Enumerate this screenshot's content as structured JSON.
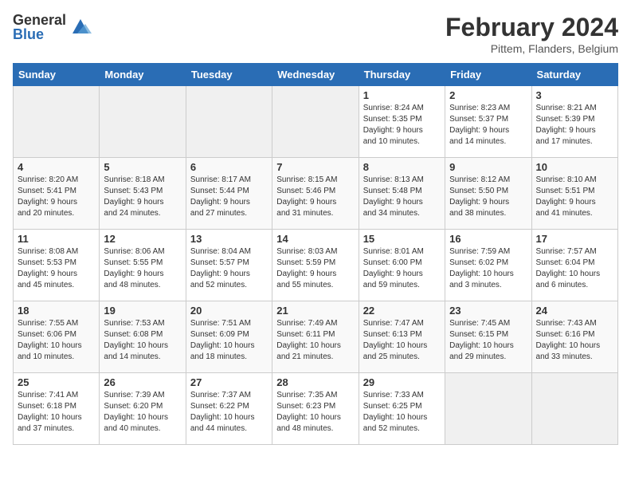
{
  "header": {
    "logo_general": "General",
    "logo_blue": "Blue",
    "month": "February 2024",
    "location": "Pittem, Flanders, Belgium"
  },
  "days_of_week": [
    "Sunday",
    "Monday",
    "Tuesday",
    "Wednesday",
    "Thursday",
    "Friday",
    "Saturday"
  ],
  "weeks": [
    [
      {
        "day": "",
        "info": ""
      },
      {
        "day": "",
        "info": ""
      },
      {
        "day": "",
        "info": ""
      },
      {
        "day": "",
        "info": ""
      },
      {
        "day": "1",
        "info": "Sunrise: 8:24 AM\nSunset: 5:35 PM\nDaylight: 9 hours\nand 10 minutes."
      },
      {
        "day": "2",
        "info": "Sunrise: 8:23 AM\nSunset: 5:37 PM\nDaylight: 9 hours\nand 14 minutes."
      },
      {
        "day": "3",
        "info": "Sunrise: 8:21 AM\nSunset: 5:39 PM\nDaylight: 9 hours\nand 17 minutes."
      }
    ],
    [
      {
        "day": "4",
        "info": "Sunrise: 8:20 AM\nSunset: 5:41 PM\nDaylight: 9 hours\nand 20 minutes."
      },
      {
        "day": "5",
        "info": "Sunrise: 8:18 AM\nSunset: 5:43 PM\nDaylight: 9 hours\nand 24 minutes."
      },
      {
        "day": "6",
        "info": "Sunrise: 8:17 AM\nSunset: 5:44 PM\nDaylight: 9 hours\nand 27 minutes."
      },
      {
        "day": "7",
        "info": "Sunrise: 8:15 AM\nSunset: 5:46 PM\nDaylight: 9 hours\nand 31 minutes."
      },
      {
        "day": "8",
        "info": "Sunrise: 8:13 AM\nSunset: 5:48 PM\nDaylight: 9 hours\nand 34 minutes."
      },
      {
        "day": "9",
        "info": "Sunrise: 8:12 AM\nSunset: 5:50 PM\nDaylight: 9 hours\nand 38 minutes."
      },
      {
        "day": "10",
        "info": "Sunrise: 8:10 AM\nSunset: 5:51 PM\nDaylight: 9 hours\nand 41 minutes."
      }
    ],
    [
      {
        "day": "11",
        "info": "Sunrise: 8:08 AM\nSunset: 5:53 PM\nDaylight: 9 hours\nand 45 minutes."
      },
      {
        "day": "12",
        "info": "Sunrise: 8:06 AM\nSunset: 5:55 PM\nDaylight: 9 hours\nand 48 minutes."
      },
      {
        "day": "13",
        "info": "Sunrise: 8:04 AM\nSunset: 5:57 PM\nDaylight: 9 hours\nand 52 minutes."
      },
      {
        "day": "14",
        "info": "Sunrise: 8:03 AM\nSunset: 5:59 PM\nDaylight: 9 hours\nand 55 minutes."
      },
      {
        "day": "15",
        "info": "Sunrise: 8:01 AM\nSunset: 6:00 PM\nDaylight: 9 hours\nand 59 minutes."
      },
      {
        "day": "16",
        "info": "Sunrise: 7:59 AM\nSunset: 6:02 PM\nDaylight: 10 hours\nand 3 minutes."
      },
      {
        "day": "17",
        "info": "Sunrise: 7:57 AM\nSunset: 6:04 PM\nDaylight: 10 hours\nand 6 minutes."
      }
    ],
    [
      {
        "day": "18",
        "info": "Sunrise: 7:55 AM\nSunset: 6:06 PM\nDaylight: 10 hours\nand 10 minutes."
      },
      {
        "day": "19",
        "info": "Sunrise: 7:53 AM\nSunset: 6:08 PM\nDaylight: 10 hours\nand 14 minutes."
      },
      {
        "day": "20",
        "info": "Sunrise: 7:51 AM\nSunset: 6:09 PM\nDaylight: 10 hours\nand 18 minutes."
      },
      {
        "day": "21",
        "info": "Sunrise: 7:49 AM\nSunset: 6:11 PM\nDaylight: 10 hours\nand 21 minutes."
      },
      {
        "day": "22",
        "info": "Sunrise: 7:47 AM\nSunset: 6:13 PM\nDaylight: 10 hours\nand 25 minutes."
      },
      {
        "day": "23",
        "info": "Sunrise: 7:45 AM\nSunset: 6:15 PM\nDaylight: 10 hours\nand 29 minutes."
      },
      {
        "day": "24",
        "info": "Sunrise: 7:43 AM\nSunset: 6:16 PM\nDaylight: 10 hours\nand 33 minutes."
      }
    ],
    [
      {
        "day": "25",
        "info": "Sunrise: 7:41 AM\nSunset: 6:18 PM\nDaylight: 10 hours\nand 37 minutes."
      },
      {
        "day": "26",
        "info": "Sunrise: 7:39 AM\nSunset: 6:20 PM\nDaylight: 10 hours\nand 40 minutes."
      },
      {
        "day": "27",
        "info": "Sunrise: 7:37 AM\nSunset: 6:22 PM\nDaylight: 10 hours\nand 44 minutes."
      },
      {
        "day": "28",
        "info": "Sunrise: 7:35 AM\nSunset: 6:23 PM\nDaylight: 10 hours\nand 48 minutes."
      },
      {
        "day": "29",
        "info": "Sunrise: 7:33 AM\nSunset: 6:25 PM\nDaylight: 10 hours\nand 52 minutes."
      },
      {
        "day": "",
        "info": ""
      },
      {
        "day": "",
        "info": ""
      }
    ]
  ]
}
